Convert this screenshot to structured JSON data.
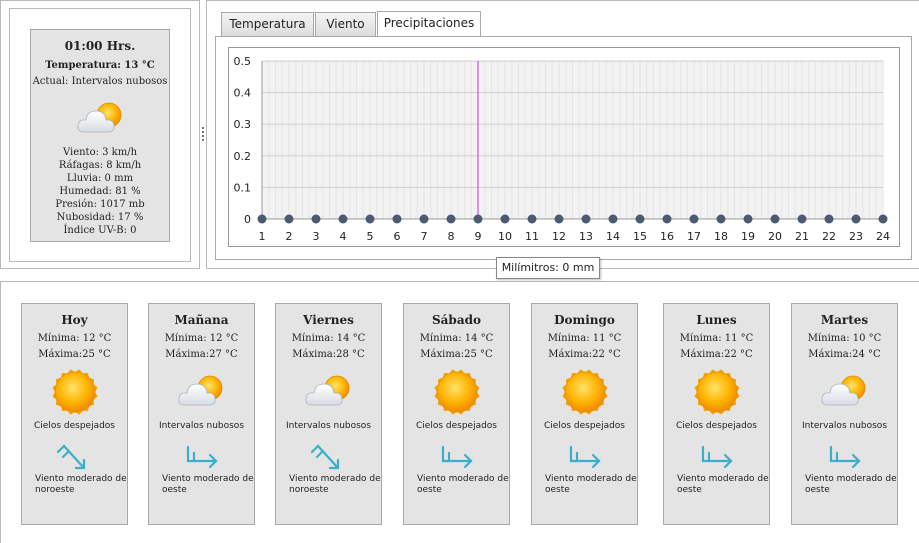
{
  "current": {
    "time": "01:00 Hrs.",
    "temperature": "Temperatura: 13 °C",
    "actual": "Actual: Intervalos nubosos",
    "icon": "partly-cloudy-icon",
    "details": [
      "Viento: 3 km/h",
      "Ráfagas: 8 km/h",
      "Lluvia: 0 mm",
      "Humedad: 81 %",
      "Presión: 1017 mb",
      "Nubosidad: 17 %",
      "Índice UV-B: 0"
    ]
  },
  "tabs": [
    {
      "label": "Temperatura",
      "active": false
    },
    {
      "label": "Viento",
      "active": false
    },
    {
      "label": "Precipitaciones",
      "active": true
    }
  ],
  "tooltip": "Milímitros: 0 mm",
  "chart_data": {
    "type": "line",
    "x": [
      1,
      2,
      3,
      4,
      5,
      6,
      7,
      8,
      9,
      10,
      11,
      12,
      13,
      14,
      15,
      16,
      17,
      18,
      19,
      20,
      21,
      22,
      23,
      24
    ],
    "series": [
      {
        "values": [
          0,
          0,
          0,
          0,
          0,
          0,
          0,
          0,
          0,
          0,
          0,
          0,
          0,
          0,
          0,
          0,
          0,
          0,
          0,
          0,
          0,
          0,
          0,
          0
        ]
      }
    ],
    "xticks": [
      "1",
      "2",
      "3",
      "4",
      "5",
      "6",
      "7",
      "8",
      "9",
      "10",
      "11",
      "12",
      "13",
      "14",
      "15",
      "16",
      "17",
      "18",
      "19",
      "20",
      "21",
      "22",
      "23",
      "24"
    ],
    "yticks": [
      "0",
      "0.1",
      "0.2",
      "0.3",
      "0.4",
      "0.5"
    ],
    "ylim": [
      0,
      0.5
    ],
    "xlim": [
      1,
      24
    ],
    "highlight_x": 9,
    "colors": {
      "marker": "#4a5a72",
      "highlight": "#cc33cc",
      "plot_bg": "#f2f2f2",
      "grid": "#dcdcdc"
    }
  },
  "forecast": [
    {
      "day": "Hoy",
      "min": "Mínima: 12 °C",
      "max": "Máxima:25 °C",
      "icon": "sun-icon",
      "condition": "Cielos despejados",
      "wind_icon": "wind-arrow-nw-icon",
      "wind_text": "Viento moderado de noroeste"
    },
    {
      "day": "Mañana",
      "min": "Mínima: 12 °C",
      "max": "Máxima:27 °C",
      "icon": "partly-cloudy-icon",
      "condition": "Intervalos nubosos",
      "wind_icon": "wind-arrow-w-icon",
      "wind_text": "Viento moderado de oeste"
    },
    {
      "day": "Viernes",
      "min": "Mínima: 14 °C",
      "max": "Máxima:28 °C",
      "icon": "partly-cloudy-icon",
      "condition": "Intervalos nubosos",
      "wind_icon": "wind-arrow-nw-icon",
      "wind_text": "Viento moderado de noroeste"
    },
    {
      "day": "Sábado",
      "min": "Mínima: 14 °C",
      "max": "Máxima:25 °C",
      "icon": "sun-icon",
      "condition": "Cielos despejados",
      "wind_icon": "wind-arrow-w-icon",
      "wind_text": "Viento moderado de oeste"
    },
    {
      "day": "Domingo",
      "min": "Mínima: 11 °C",
      "max": "Máxima:22 °C",
      "icon": "sun-icon",
      "condition": "Cielos despejados",
      "wind_icon": "wind-arrow-w-icon",
      "wind_text": "Viento moderado de oeste"
    },
    {
      "day": "Lunes",
      "min": "Mínima: 11 °C",
      "max": "Máxima:22 °C",
      "icon": "sun-icon",
      "condition": "Cielos despejados",
      "wind_icon": "wind-arrow-w-icon",
      "wind_text": "Viento moderado de oeste"
    },
    {
      "day": "Martes",
      "min": "Mínima: 10 °C",
      "max": "Máxima:24 °C",
      "icon": "partly-cloudy-icon",
      "condition": "Intervalos nubosos",
      "wind_icon": "wind-arrow-w-icon",
      "wind_text": "Viento moderado de oeste"
    }
  ]
}
